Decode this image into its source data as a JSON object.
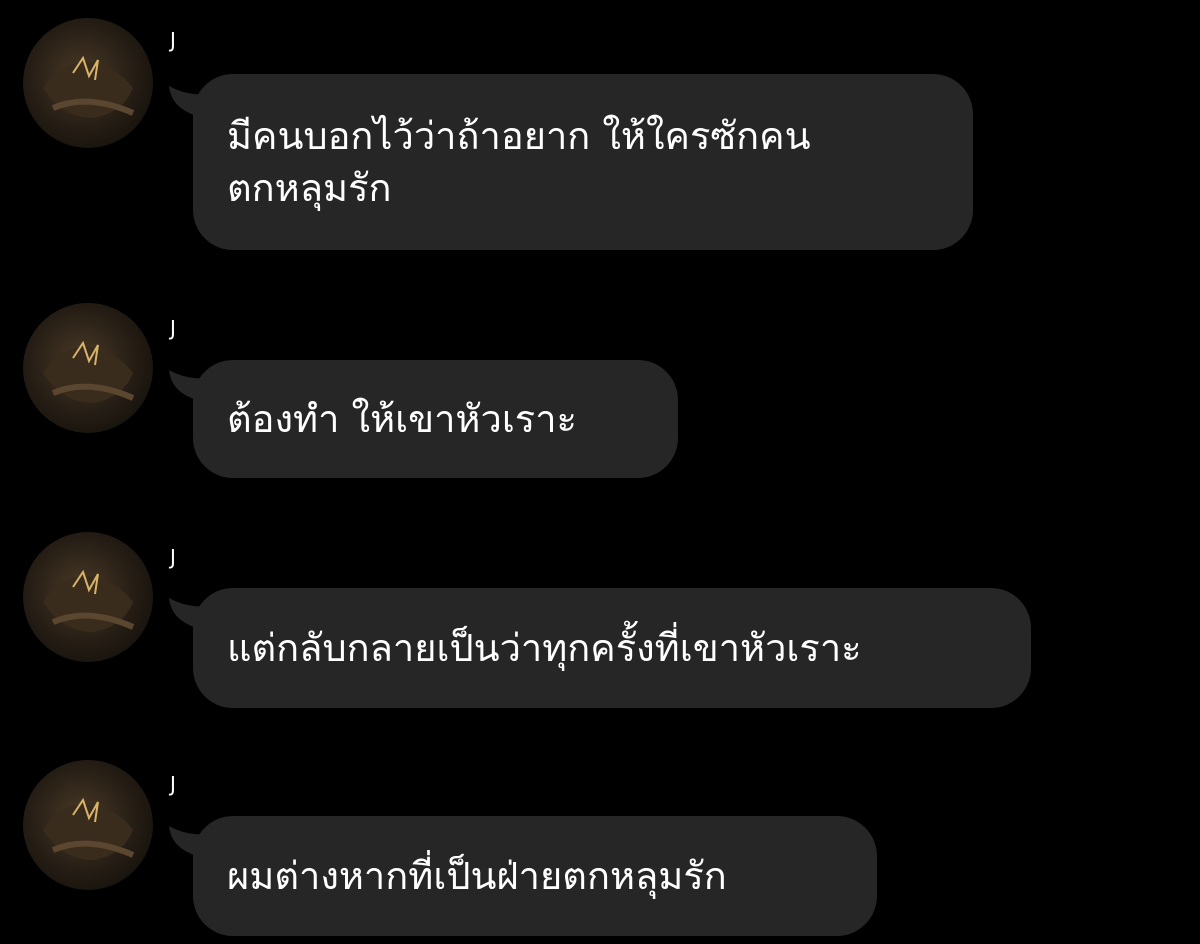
{
  "messages": [
    {
      "sender": "J",
      "text": "มีคนบอกไว้ว่าถ้าอยาก ให้ใครซักคน\nตกหลุมรัก",
      "avatar": "profile-photo"
    },
    {
      "sender": "J",
      "text": "ต้องทำ ให้เขาหัวเราะ",
      "avatar": "profile-photo"
    },
    {
      "sender": "J",
      "text": "แต่กลับกลายเป็นว่าทุกครั้งที่เขาหัวเราะ",
      "avatar": "profile-photo"
    },
    {
      "sender": "J",
      "text": "ผมต่างหากที่เป็นฝ่ายตกหลุมรัก",
      "avatar": "profile-photo"
    }
  ],
  "colors": {
    "background": "#000000",
    "bubble": "#262626",
    "text": "#ffffff"
  }
}
